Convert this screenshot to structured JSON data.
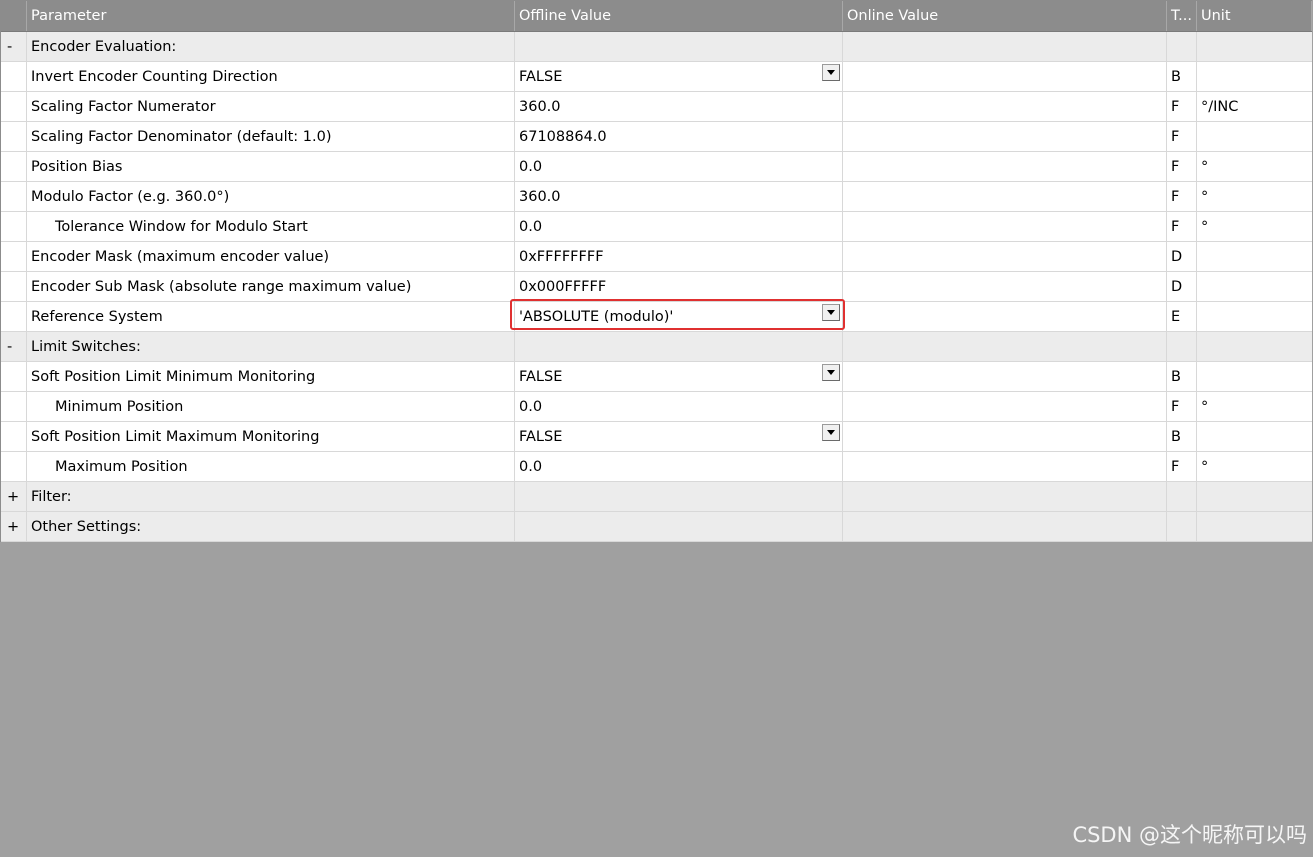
{
  "columns": {
    "parameter": "Parameter",
    "offline": "Offline Value",
    "online": "Online Value",
    "type": "T...",
    "unit": "Unit"
  },
  "groups": {
    "encoder": {
      "toggle": "-",
      "label": "Encoder Evaluation:"
    },
    "limits": {
      "toggle": "-",
      "label": "Limit Switches:"
    },
    "filter": {
      "toggle": "+",
      "label": "Filter:"
    },
    "other": {
      "toggle": "+",
      "label": "Other Settings:"
    }
  },
  "encoder_rows": [
    {
      "name": "Invert Encoder Counting Direction",
      "value": "FALSE",
      "online": "",
      "type": "B",
      "unit": ""
    },
    {
      "name": "Scaling Factor Numerator",
      "value": "360.0",
      "online": "",
      "type": "F",
      "unit": "°/INC"
    },
    {
      "name": "Scaling Factor Denominator (default: 1.0)",
      "value": "67108864.0",
      "online": "",
      "type": "F",
      "unit": ""
    },
    {
      "name": "Position Bias",
      "value": "0.0",
      "online": "",
      "type": "F",
      "unit": "°"
    },
    {
      "name": "Modulo Factor (e.g. 360.0°)",
      "value": "360.0",
      "online": "",
      "type": "F",
      "unit": "°"
    },
    {
      "name": "Tolerance Window for Modulo Start",
      "value": "0.0",
      "online": "",
      "type": "F",
      "unit": "°"
    },
    {
      "name": "Encoder Mask (maximum encoder value)",
      "value": "0xFFFFFFFF",
      "online": "",
      "type": "D",
      "unit": ""
    },
    {
      "name": "Encoder Sub Mask (absolute range maximum value)",
      "value": "0x000FFFFF",
      "online": "",
      "type": "D",
      "unit": ""
    },
    {
      "name": "Reference System",
      "value": "'ABSOLUTE (modulo)'",
      "online": "",
      "type": "E",
      "unit": ""
    }
  ],
  "limit_rows": [
    {
      "name": "Soft Position Limit Minimum Monitoring",
      "value": "FALSE",
      "online": "",
      "type": "B",
      "unit": ""
    },
    {
      "name": "Minimum Position",
      "value": "0.0",
      "online": "",
      "type": "F",
      "unit": "°"
    },
    {
      "name": "Soft Position Limit Maximum Monitoring",
      "value": "FALSE",
      "online": "",
      "type": "B",
      "unit": ""
    },
    {
      "name": "Maximum Position",
      "value": "0.0",
      "online": "",
      "type": "F",
      "unit": "°"
    }
  ],
  "watermark": "CSDN @这个昵称可以吗"
}
